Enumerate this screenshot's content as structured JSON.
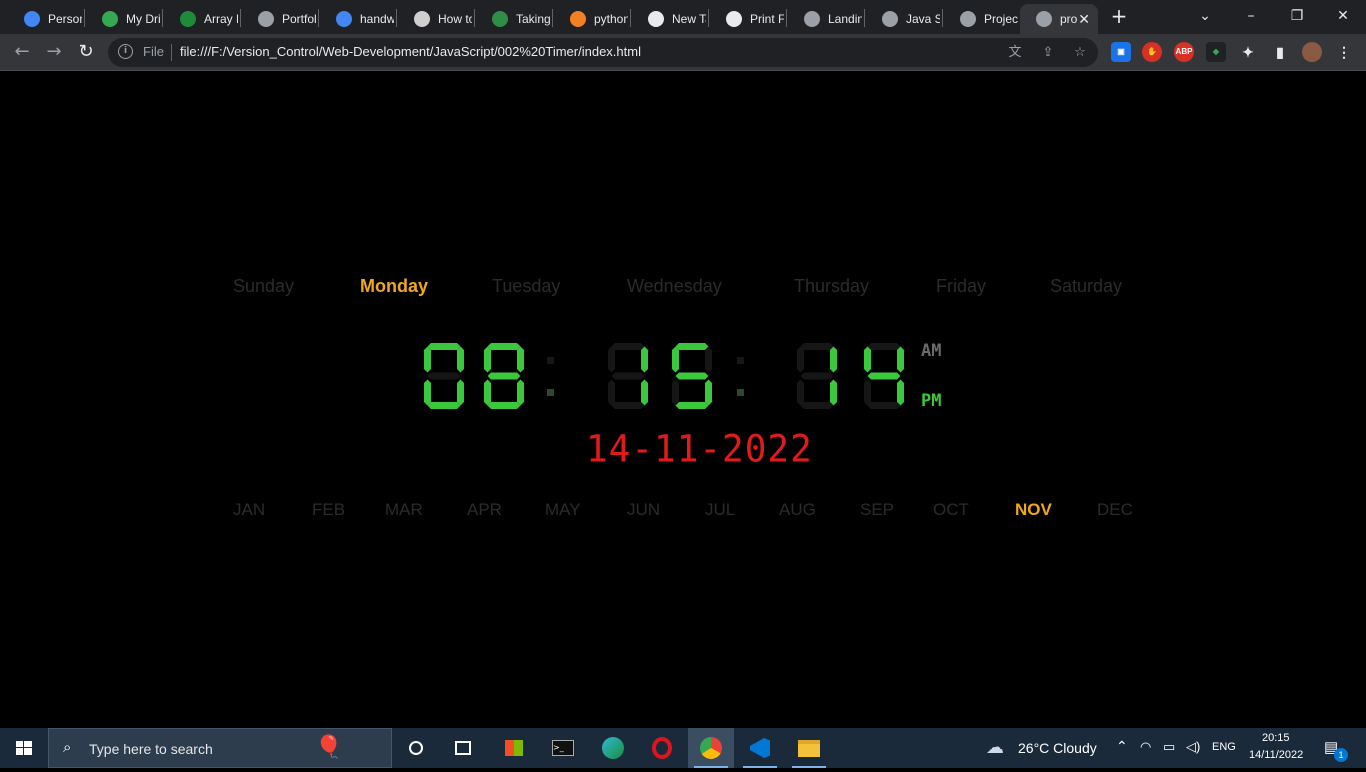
{
  "browser": {
    "tabs": [
      {
        "label": "Person",
        "icon": "google-icon",
        "color": "#4285f4"
      },
      {
        "label": "My Dri",
        "icon": "google-drive-icon",
        "color": "#34a853"
      },
      {
        "label": "Array M",
        "icon": "array-icon",
        "color": "#1f8a3a"
      },
      {
        "label": "Portfoli",
        "icon": "globe-icon",
        "color": "#9aa0a6"
      },
      {
        "label": "handw",
        "icon": "google-icon",
        "color": "#4285f4"
      },
      {
        "label": "How to",
        "icon": "codepen-icon",
        "color": "#cfcfcf"
      },
      {
        "label": "Taking",
        "icon": "geeksforgeeks-icon",
        "color": "#2f8d46"
      },
      {
        "label": "python",
        "icon": "stackoverflow-icon",
        "color": "#f48024"
      },
      {
        "label": "New Ta",
        "icon": "chrome-icon",
        "color": "#e8eaed"
      },
      {
        "label": "Print Fr",
        "icon": "printer-icon",
        "color": "#e8eaed"
      },
      {
        "label": "Landin",
        "icon": "globe-icon",
        "color": "#9aa0a6"
      },
      {
        "label": "Java Sc",
        "icon": "globe-icon",
        "color": "#9aa0a6"
      },
      {
        "label": "Project",
        "icon": "globe-icon",
        "color": "#9aa0a6"
      },
      {
        "label": "pro",
        "icon": "globe-icon",
        "color": "#9aa0a6"
      }
    ],
    "omnibox": {
      "scheme_label": "File",
      "url": "file:///F:/Version_Control/Web-Development/JavaScript/002%20Timer/index.html"
    },
    "extensions": [
      "ABP"
    ]
  },
  "clock_page": {
    "days": [
      "Sunday",
      "Monday",
      "Tuesday",
      "Wednesday",
      "Thursday",
      "Friday",
      "Saturday"
    ],
    "active_day": "Monday",
    "time": {
      "hours": "08",
      "minutes": "15",
      "seconds": "14"
    },
    "am_label": "AM",
    "pm_label": "PM",
    "period": "PM",
    "date": "14-11-2022",
    "months": [
      "JAN",
      "FEB",
      "MAR",
      "APR",
      "MAY",
      "JUN",
      "JUL",
      "AUG",
      "SEP",
      "OCT",
      "NOV",
      "DEC"
    ],
    "active_month": "NOV",
    "colors": {
      "active": "#f0a81b",
      "inactive": "#2b2b2b",
      "digit_on": "#3cc83c",
      "digit_off": "#161616",
      "date": "#e21a1a"
    }
  },
  "taskbar": {
    "search_placeholder": "Type here to search",
    "weather": "26°C  Cloudy",
    "language": "ENG",
    "time": "20:15",
    "date": "14/11/2022",
    "notification_count": "1"
  }
}
